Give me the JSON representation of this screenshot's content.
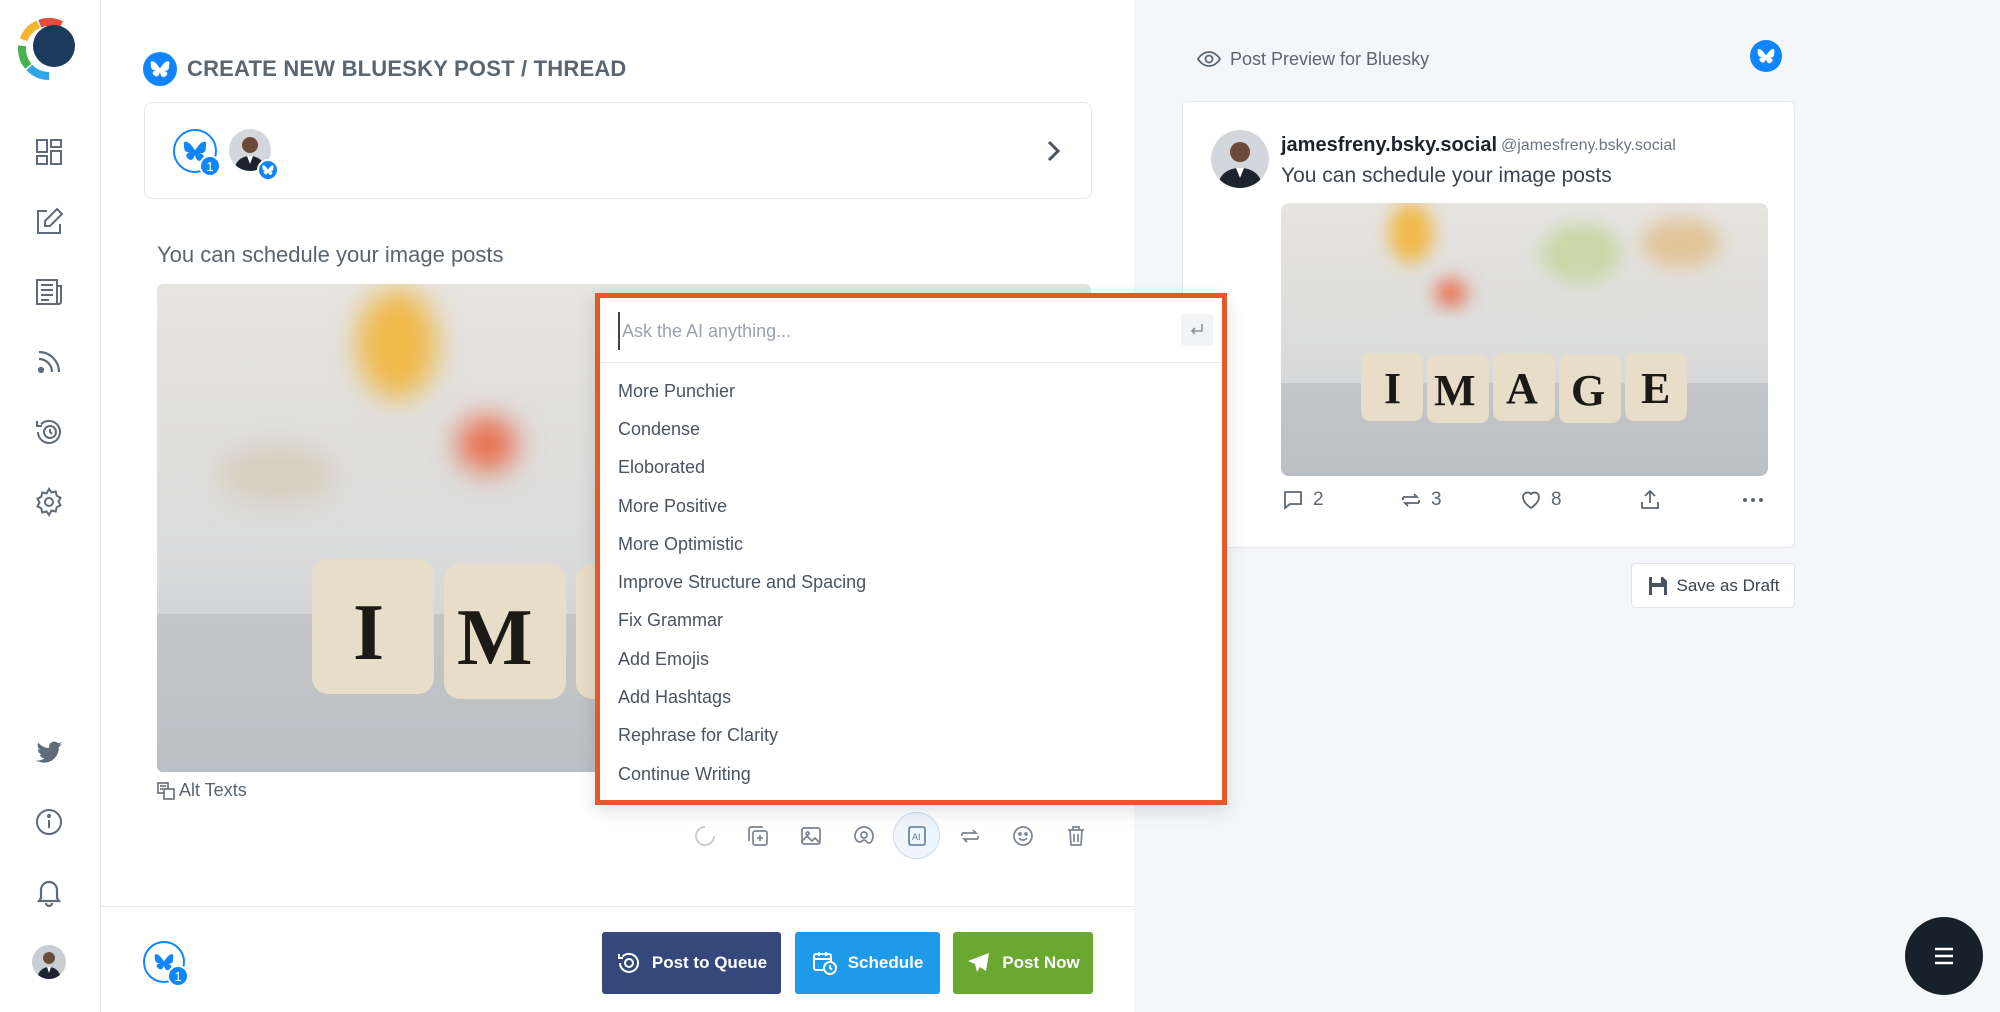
{
  "sidebar": {
    "nav": [
      "dashboard-icon",
      "compose-icon",
      "posts-icon",
      "rss-icon",
      "queue-icon",
      "settings-icon"
    ],
    "bottom": [
      "twitter-icon",
      "info-icon",
      "bell-icon"
    ]
  },
  "editor": {
    "title": "CREATE NEW BLUESKY POST / THREAD",
    "account_count": "1",
    "post_text": "You can schedule your image posts",
    "alt_texts_label": "Alt Texts",
    "image_caption": "IMAGE"
  },
  "ai_menu": {
    "placeholder": "Ask the AI anything...",
    "options": [
      "More Punchier",
      "Condense",
      "Eloborated",
      "More Positive",
      "More Optimistic",
      "Improve Structure and Spacing",
      "Fix Grammar",
      "Add Emojis",
      "Add Hashtags",
      "Rephrase for Clarity",
      "Continue Writing"
    ]
  },
  "footer": {
    "count": "1",
    "post_to_queue": "Post to Queue",
    "schedule": "Schedule",
    "post_now": "Post Now"
  },
  "preview": {
    "header": "Post Preview for Bluesky",
    "name": "jamesfreny.bsky.social",
    "handle": "@jamesfreny.bsky.social",
    "text": "You can schedule your image posts",
    "image_caption": "IMAGE",
    "replies": "2",
    "reposts": "3",
    "likes": "8",
    "save_draft": "Save as Draft"
  },
  "colors": {
    "bluesky": "#1185fe",
    "queue_button": "#34487a",
    "schedule_button": "#1e9ae8",
    "post_now_button": "#6aa832",
    "ai_highlight_border": "#e05a2b"
  }
}
